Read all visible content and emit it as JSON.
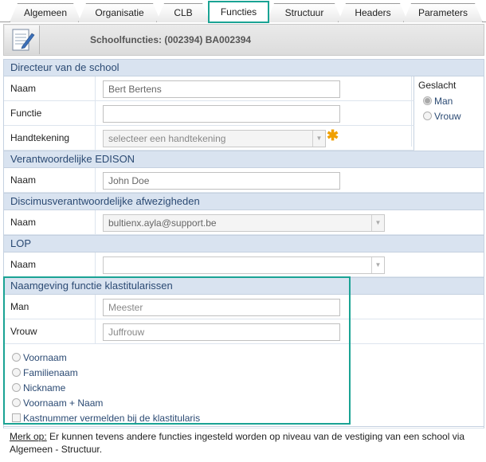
{
  "tabs": [
    "Algemeen",
    "Organisatie",
    "CLB",
    "Functies",
    "Structuur",
    "Headers",
    "Parameters"
  ],
  "header": {
    "title": "Schoolfuncties: (002394) BA002394",
    "icon": "notepad-pencil-icon"
  },
  "directeur": {
    "section": "Directeur van de school",
    "naam_label": "Naam",
    "naam_value": "Bert Bertens",
    "functie_label": "Functie",
    "functie_value": "",
    "handtekening_label": "Handtekening",
    "handtekening_value": "selecteer een handtekening",
    "geslacht_label": "Geslacht",
    "man": "Man",
    "vrouw": "Vrouw"
  },
  "edison": {
    "section": "Verantwoordelijke EDISON",
    "naam_label": "Naam",
    "naam_value": "John Doe"
  },
  "discimus": {
    "section": "Discimusverantwoordelijke afwezigheden",
    "naam_label": "Naam",
    "naam_value": "bultienx.ayla@support.be"
  },
  "lop": {
    "section": "LOP",
    "naam_label": "Naam",
    "naam_value": ""
  },
  "klastitularissen": {
    "section": "Naamgeving functie klastitularissen",
    "man_label": "Man",
    "man_placeholder": "Meester",
    "vrouw_label": "Vrouw",
    "vrouw_placeholder": "Juffrouw",
    "options": [
      "Voornaam",
      "Familienaam",
      "Nickname",
      "Voornaam + Naam"
    ],
    "checkbox": "Kastnummer vermelden bij de klastitularis"
  },
  "remark": {
    "prefix": "Merk op:",
    "text": " Er kunnen tevens andere functies ingesteld worden op niveau van de vestiging van een school via Algemeen - Structuur."
  },
  "colors": {
    "accent": "#1aa394",
    "section_bg": "#d9e3f0",
    "section_text": "#2b4a73",
    "star": "#f0a000"
  }
}
